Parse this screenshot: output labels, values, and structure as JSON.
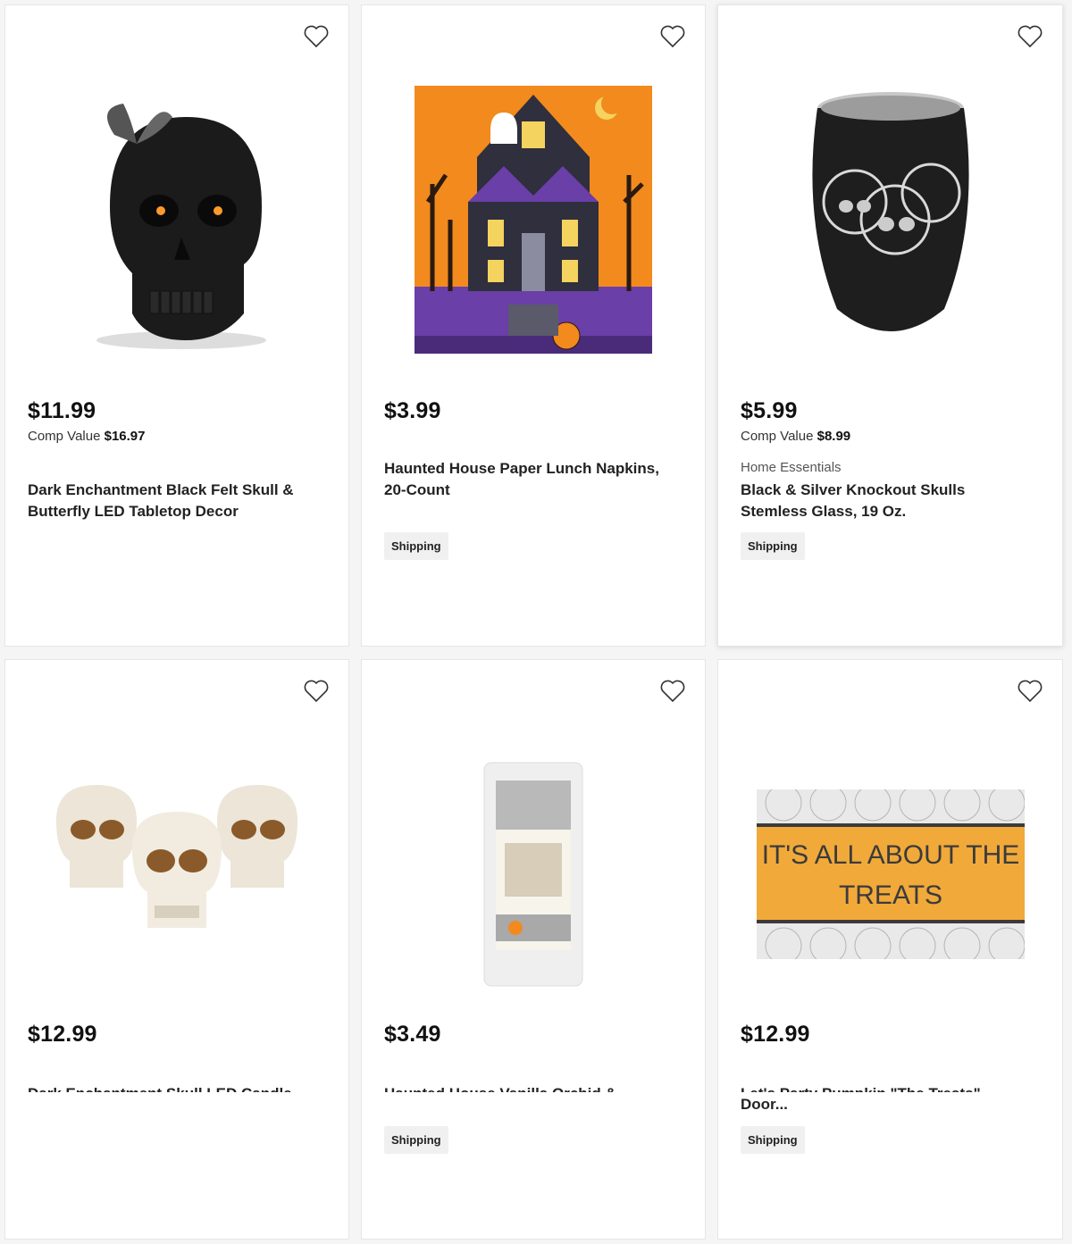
{
  "products": [
    {
      "price": "$11.99",
      "comp_label": "Comp Value",
      "comp_value": "$16.97",
      "brand": "",
      "title": "Dark Enchantment Black Felt Skull & Butterfly LED Tabletop Decor",
      "shipping": ""
    },
    {
      "price": "$3.99",
      "comp_label": "",
      "comp_value": "",
      "brand": "",
      "title": "Haunted House Paper Lunch Napkins, 20-Count",
      "shipping": "Shipping"
    },
    {
      "price": "$5.99",
      "comp_label": "Comp Value",
      "comp_value": "$8.99",
      "brand": "Home Essentials",
      "title": "Black & Silver Knockout Skulls Stemless Glass, 19 Oz.",
      "shipping": "Shipping"
    },
    {
      "price": "$12.99",
      "comp_label": "",
      "comp_value": "",
      "brand": "",
      "title": "Dark Enchantment Skull LED Candle",
      "shipping": ""
    },
    {
      "price": "$3.49",
      "comp_label": "",
      "comp_value": "",
      "brand": "",
      "title": "Haunted House Vanilla Orchid &",
      "shipping": "Shipping"
    },
    {
      "price": "$12.99",
      "comp_label": "",
      "comp_value": "",
      "brand": "",
      "title": "Let's Party Pumpkin \"The Treats\"",
      "title2": "Door...",
      "shipping": "Shipping"
    }
  ],
  "images": {
    "napkin_mat_text": "",
    "doormat_line1": "IT'S ALL ABOUT THE",
    "doormat_line2": "TREATS"
  },
  "icons": {
    "wishlist": "heart-outline-icon"
  }
}
